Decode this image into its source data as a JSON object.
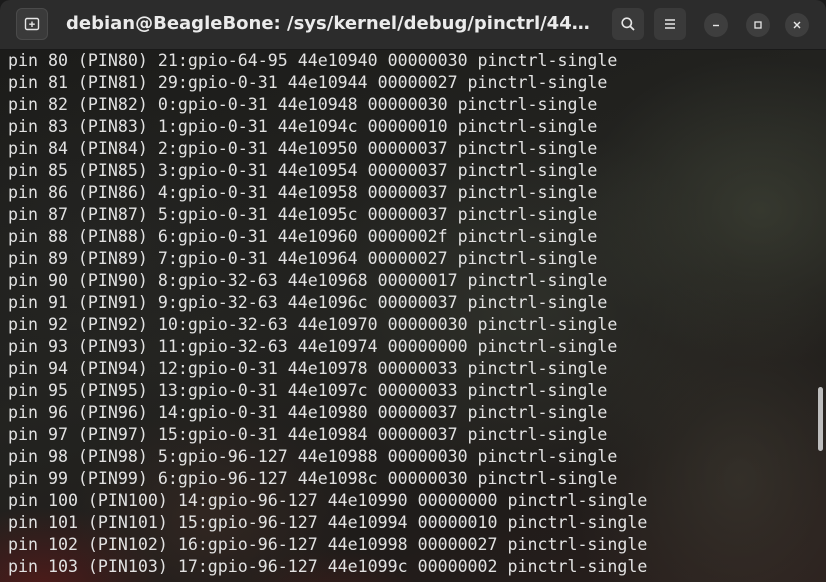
{
  "window": {
    "title": "debian@BeagleBone: /sys/kernel/debug/pinctrl/44e..."
  },
  "icons": {
    "new_tab": "new-tab-icon",
    "search": "search-icon",
    "menu": "hamburger-menu-icon",
    "minimize": "minimize-icon",
    "maximize": "maximize-icon",
    "close": "close-icon"
  },
  "terminal": {
    "lines": [
      "pin 80 (PIN80) 21:gpio-64-95 44e10940 00000030 pinctrl-single",
      "pin 81 (PIN81) 29:gpio-0-31 44e10944 00000027 pinctrl-single",
      "pin 82 (PIN82) 0:gpio-0-31 44e10948 00000030 pinctrl-single",
      "pin 83 (PIN83) 1:gpio-0-31 44e1094c 00000010 pinctrl-single",
      "pin 84 (PIN84) 2:gpio-0-31 44e10950 00000037 pinctrl-single",
      "pin 85 (PIN85) 3:gpio-0-31 44e10954 00000037 pinctrl-single",
      "pin 86 (PIN86) 4:gpio-0-31 44e10958 00000037 pinctrl-single",
      "pin 87 (PIN87) 5:gpio-0-31 44e1095c 00000037 pinctrl-single",
      "pin 88 (PIN88) 6:gpio-0-31 44e10960 0000002f pinctrl-single",
      "pin 89 (PIN89) 7:gpio-0-31 44e10964 00000027 pinctrl-single",
      "pin 90 (PIN90) 8:gpio-32-63 44e10968 00000017 pinctrl-single",
      "pin 91 (PIN91) 9:gpio-32-63 44e1096c 00000037 pinctrl-single",
      "pin 92 (PIN92) 10:gpio-32-63 44e10970 00000030 pinctrl-single",
      "pin 93 (PIN93) 11:gpio-32-63 44e10974 00000000 pinctrl-single",
      "pin 94 (PIN94) 12:gpio-0-31 44e10978 00000033 pinctrl-single",
      "pin 95 (PIN95) 13:gpio-0-31 44e1097c 00000033 pinctrl-single",
      "pin 96 (PIN96) 14:gpio-0-31 44e10980 00000037 pinctrl-single",
      "pin 97 (PIN97) 15:gpio-0-31 44e10984 00000037 pinctrl-single",
      "pin 98 (PIN98) 5:gpio-96-127 44e10988 00000030 pinctrl-single",
      "pin 99 (PIN99) 6:gpio-96-127 44e1098c 00000030 pinctrl-single",
      "pin 100 (PIN100) 14:gpio-96-127 44e10990 00000000 pinctrl-single",
      "pin 101 (PIN101) 15:gpio-96-127 44e10994 00000010 pinctrl-single",
      "pin 102 (PIN102) 16:gpio-96-127 44e10998 00000027 pinctrl-single",
      "pin 103 (PIN103) 17:gpio-96-127 44e1099c 00000002 pinctrl-single"
    ]
  },
  "scroll": {
    "position_fraction": 0.72
  },
  "colors": {
    "titlebar": "#2c2c2c",
    "text": "#e2e2e2",
    "scroll_thumb": "#bdbdbd"
  }
}
